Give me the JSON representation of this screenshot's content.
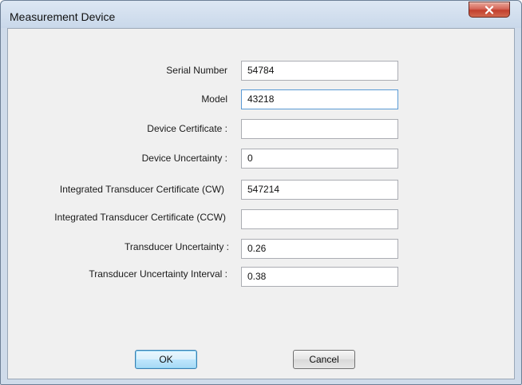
{
  "window": {
    "title": "Measurement Device"
  },
  "form": {
    "fields": [
      {
        "label": "Serial Number",
        "value": "54784"
      },
      {
        "label": "Model",
        "value": "43218"
      },
      {
        "label": "Device Certificate :",
        "value": ""
      },
      {
        "label": "Device Uncertainty :",
        "value": "0"
      },
      {
        "label": "Integrated Transducer Certificate (CW)",
        "value": "547214"
      },
      {
        "label": "Integrated Transducer Certificate (CCW)",
        "value": ""
      },
      {
        "label": "Transducer Uncertainty :",
        "value": "0.26"
      },
      {
        "label": "Transducer Uncertainty Interval :",
        "value": "0.38"
      }
    ]
  },
  "buttons": {
    "ok_label": "OK",
    "cancel_label": "Cancel"
  },
  "colors": {
    "title_bar": "#cfdbea",
    "close_button": "#c94a36",
    "client_background": "#f0f0f0",
    "focused_field_border": "#5b9bd5"
  },
  "icons": {
    "close": "close-icon"
  }
}
